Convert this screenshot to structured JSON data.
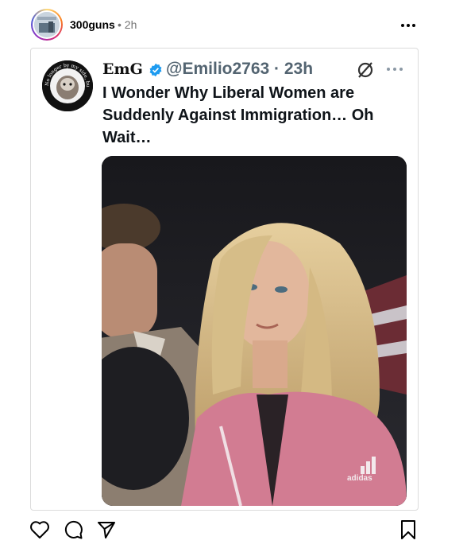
{
  "post": {
    "username": "300guns",
    "meta": "• 2h",
    "more_icon": "more-horizontal-icon"
  },
  "quoted": {
    "display_name": "EmG",
    "verified_color": "#1d9bf0",
    "handle_time": "@Emilio2763 · 23h",
    "text": "I Wonder Why Liberal Women are Suddenly Against Immigration… Oh Wait…",
    "avatar_caption": "No longer by my side, but forever in my heart",
    "watermark": "adidas"
  },
  "actions": {
    "like_icon": "heart-icon",
    "comment_icon": "comment-icon",
    "share_icon": "send-icon",
    "save_icon": "bookmark-icon"
  }
}
